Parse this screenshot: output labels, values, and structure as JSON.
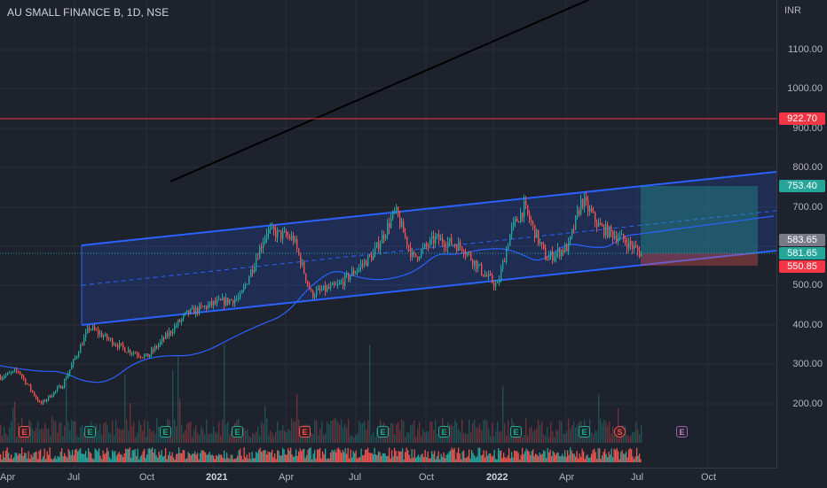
{
  "header": {
    "symbol_title": "AU SMALL FINANCE B, 1D, NSE"
  },
  "price_axis": {
    "currency": "INR",
    "ticks": [
      "1100.00",
      "1000.00",
      "900.00",
      "800.00",
      "700.00",
      "500.00",
      "400.00",
      "300.00",
      "200.00"
    ],
    "tags": {
      "horizontal_line": "922.70",
      "target": "753.40",
      "entry": "583.65",
      "last_price": "581.65",
      "stop": "550.85"
    }
  },
  "time_axis": {
    "labels": [
      "Apr",
      "Jul",
      "Oct",
      "2021",
      "Apr",
      "Jul",
      "Oct",
      "2022",
      "Apr",
      "Jul",
      "Oct"
    ]
  },
  "events": [
    {
      "letter": "E",
      "kind": "red"
    },
    {
      "letter": "E",
      "kind": "green"
    },
    {
      "letter": "E",
      "kind": "green"
    },
    {
      "letter": "E",
      "kind": "green"
    },
    {
      "letter": "E",
      "kind": "red"
    },
    {
      "letter": "E",
      "kind": "green"
    },
    {
      "letter": "E",
      "kind": "green"
    },
    {
      "letter": "E",
      "kind": "green"
    },
    {
      "letter": "E",
      "kind": "green"
    },
    {
      "letter": "S",
      "kind": "split"
    },
    {
      "letter": "E",
      "kind": "future"
    }
  ],
  "colors": {
    "background": "#1e222d",
    "grid": "#2a2e39",
    "up": "#26a69a",
    "down": "#ef5350",
    "channel": "#2962ff",
    "horizontal_line": "#f23645",
    "moving_average": "#2962ff",
    "target_zone": "#26a69a",
    "stop_zone": "#ef5350"
  },
  "icons": {
    "event_earnings": "E-badge",
    "event_split": "S-circle"
  }
}
